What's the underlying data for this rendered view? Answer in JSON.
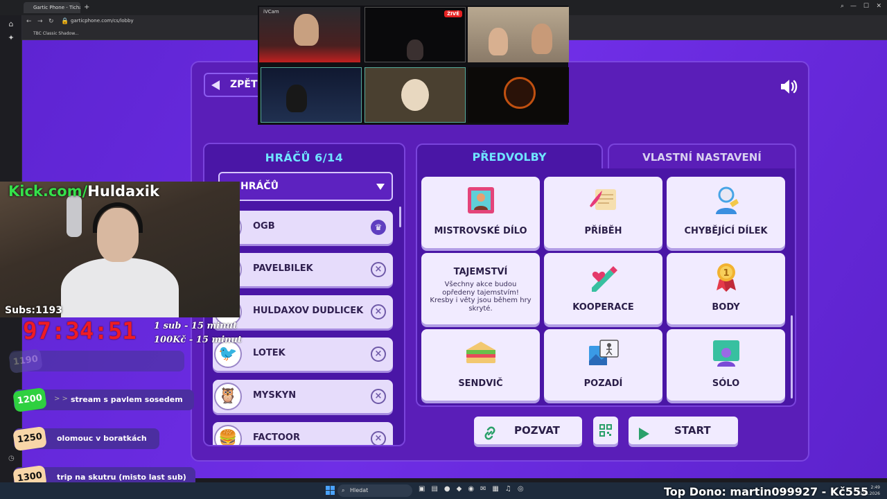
{
  "browser": {
    "tab_title": "Gartic Phone - Tichá ...",
    "url": "garticphone.com/cs/lobby",
    "bookmark": "TBC Classic Shadow...",
    "new_tab": "+"
  },
  "game": {
    "back_label": "ZPĚT",
    "players_title": "HRÁČŮ 6/14",
    "players_select": "HRÁČŮ",
    "players": [
      {
        "name": "OGB",
        "action": "crown"
      },
      {
        "name": "PAVELBILEK",
        "action": "kick"
      },
      {
        "name": "HULDAXOV DUDLICEK",
        "action": "kick"
      },
      {
        "name": "LOTEK",
        "action": "kick"
      },
      {
        "name": "MYSKYN",
        "action": "kick"
      },
      {
        "name": "FACTOOR",
        "action": "kick"
      }
    ],
    "tab_presets": "PŘEDVOLBY",
    "tab_custom": "VLASTNÍ NASTAVENÍ",
    "presets": [
      {
        "label": "MISTROVSKÉ DÍLO",
        "icon": "painting-icon"
      },
      {
        "label": "PŘÍBĚH",
        "icon": "scroll-quill-icon"
      },
      {
        "label": "CHYBĚJÍCÍ DÍLEK",
        "icon": "puzzle-icon"
      },
      {
        "label": "TAJEMSTVÍ",
        "icon": "",
        "description": "Všechny akce budou opředeny tajemstvím! Kresby i věty jsou během hry skryté."
      },
      {
        "label": "KOOPERACE",
        "icon": "pencil-heart-icon"
      },
      {
        "label": "BODY",
        "icon": "medal-icon"
      },
      {
        "label": "SENDVIČ",
        "icon": "sandwich-icon"
      },
      {
        "label": "POZADÍ",
        "icon": "background-image-icon"
      },
      {
        "label": "SÓLO",
        "icon": "solo-player-icon"
      }
    ],
    "invite_label": "POZVAT",
    "start_label": "START"
  },
  "cams": {
    "label": "iVCam",
    "live": "ŽIVĚ"
  },
  "stream": {
    "kick_prefix": "Kick.com/",
    "kick_name": "Huldaxik",
    "subs": "Subs:1193",
    "timer": "97:34:51",
    "rate_sub": "1 sub - 15 minut",
    "rate_money": "100Kč - 15 minut",
    "goals": [
      {
        "num": "1190",
        "text": ""
      },
      {
        "num": "1200",
        "text": "stream s pavlem sosedem"
      },
      {
        "num": "1250",
        "text": "olomouc v boratkách"
      },
      {
        "num": "1300",
        "text": "trip na skutru (misto last sub)"
      }
    ],
    "goal_arrows": "> >",
    "top_dono": "Top Dono: martin099927 - Kč555"
  },
  "taskbar": {
    "search": "Hledat",
    "time": "2:49",
    "date": "20.03.2026"
  },
  "colors": {
    "page_bg": "#6c2ee0",
    "panel": "#4a16a6",
    "accent_cyan": "#6fe4ff",
    "card": "#f1ebff",
    "timer_red": "#ee1c24",
    "kick_green": "#35e04a"
  }
}
